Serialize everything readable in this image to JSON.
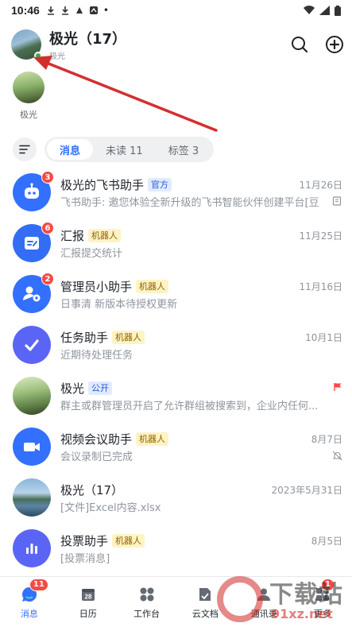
{
  "statusbar": {
    "time": "10:46",
    "dot": "•"
  },
  "header": {
    "title": "极光（17）",
    "subtitle": "极光"
  },
  "pinned": {
    "label": "极光"
  },
  "tabs": [
    {
      "label": "消息",
      "active": true
    },
    {
      "label": "未读 11",
      "active": false
    },
    {
      "label": "标签 3",
      "active": false
    }
  ],
  "chats": [
    {
      "name": "极光的飞书助手",
      "tag": "官方",
      "tag_type": "official",
      "time": "11月26日",
      "preview": "飞书助手: 邀您体验全新升级的飞书智能伙伴创建平台[豆",
      "badge": "3",
      "icon": "robot-icon",
      "side": "book-icon"
    },
    {
      "name": "汇报",
      "tag": "机器人",
      "tag_type": "bot",
      "time": "11月25日",
      "preview": "汇报提交统计",
      "badge": "6",
      "icon": "report-icon",
      "side": ""
    },
    {
      "name": "管理员小助手",
      "tag": "机器人",
      "tag_type": "bot",
      "time": "11月16日",
      "preview": "日事清 新版本待授权更新",
      "badge": "2",
      "icon": "admin-gear-icon",
      "side": ""
    },
    {
      "name": "任务助手",
      "tag": "机器人",
      "tag_type": "bot",
      "time": "10月1日",
      "preview": "近期待处理任务",
      "badge": "",
      "icon": "checkmark-icon",
      "side": ""
    },
    {
      "name": "极光",
      "tag": "公开",
      "tag_type": "public",
      "time": "",
      "preview": "群主或群管理员开启了允许群组被搜索到，企业内任何...",
      "badge": "",
      "icon": "photo-green",
      "side": "flag-icon"
    },
    {
      "name": "视频会议助手",
      "tag": "机器人",
      "tag_type": "bot",
      "time": "8月7日",
      "preview": "会议录制已完成",
      "badge": "",
      "icon": "video-camera-icon",
      "side": "mute-bell-icon"
    },
    {
      "name": "极光（17）",
      "tag": "",
      "tag_type": "",
      "time": "2023年5月31日",
      "preview": "[文件]Excel内容.xlsx",
      "badge": "",
      "icon": "photo-lake",
      "side": ""
    },
    {
      "name": "投票助手",
      "tag": "机器人",
      "tag_type": "bot",
      "time": "8月5日",
      "preview": "[投票消息]",
      "badge": "",
      "icon": "poll-chart-icon",
      "side": ""
    }
  ],
  "nav": [
    {
      "label": "消息",
      "icon": "chat-bubble-icon",
      "badge": "11",
      "active": true
    },
    {
      "label": "日历",
      "icon": "calendar-icon",
      "badge": "",
      "active": false,
      "cal_day": "28"
    },
    {
      "label": "工作台",
      "icon": "grid-icon",
      "badge": "",
      "active": false
    },
    {
      "label": "云文档",
      "icon": "document-icon",
      "badge": "",
      "active": false
    },
    {
      "label": "通讯录",
      "icon": "contacts-icon",
      "badge": "",
      "active": false
    },
    {
      "label": "更多",
      "icon": "more-icon",
      "badge": "1",
      "active": false
    }
  ],
  "watermark": {
    "mark": "9",
    "text1": "下载站",
    "text2": "91xz.net"
  },
  "colors": {
    "accent": "#3370ff",
    "badge": "#f54a45",
    "arrow": "#d42f2f",
    "bot_tag_bg": "#fdf3c4",
    "official_tag_bg": "#e1eaff"
  }
}
